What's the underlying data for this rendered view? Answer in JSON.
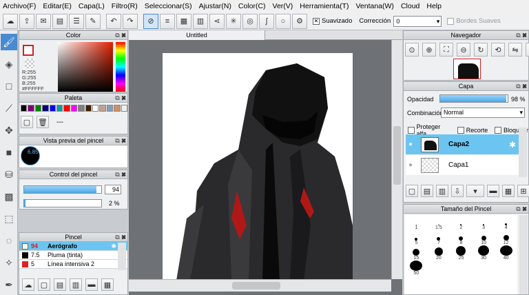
{
  "menu": [
    "Archivo(F)",
    "Editar(E)",
    "Capa(L)",
    "Filtro(R)",
    "Seleccionar(S)",
    "Ajustar(N)",
    "Color(C)",
    "Ver(V)",
    "Herramienta(T)",
    "Ventana(W)",
    "Cloud",
    "Help"
  ],
  "toolbar": {
    "smooth_label": "Suavizado",
    "correction_label": "Corrección",
    "correction_value": "0",
    "soft_edges_label": "Bordes Suaves"
  },
  "color_panel": {
    "title": "Color",
    "r": "R:255",
    "g": "G:255",
    "b": "B:255",
    "hex": "#FFFFFF"
  },
  "palette_panel": {
    "title": "Paleta",
    "dashes": "---",
    "swatches": [
      "#000000",
      "#800080",
      "#008000",
      "#000080",
      "#0000ff",
      "#00a0a0",
      "#ff0000",
      "#ff00ff",
      "#808080",
      "#402000",
      "#ffffff",
      "#c0a090",
      "#80a0c0",
      "#d09060",
      "#f0f0f0"
    ]
  },
  "brush_preview": {
    "title": "Vista previa del pincel",
    "size": "6.85"
  },
  "brush_control": {
    "title": "Control del pincel",
    "size": "94",
    "opacity": "2 %",
    "size_fill": 0.94,
    "opacity_fill": 0.02
  },
  "brush_panel": {
    "title": "Pincel",
    "items": [
      {
        "size": "94",
        "name": "Aerógrafo",
        "color": "#ffffff"
      },
      {
        "size": "7.5",
        "name": "Pluma (tinta)",
        "color": "#000000"
      },
      {
        "size": "5",
        "name": "Línea intensiva 2",
        "color": "#e02020"
      }
    ]
  },
  "document": {
    "tab": "Untitled"
  },
  "navigator": {
    "title": "Navegador"
  },
  "layer_panel": {
    "title": "Capa",
    "opacity_label": "Opacidad",
    "opacity_value": "98 %",
    "opacity_fill": 0.98,
    "blend_label": "Combinación",
    "blend_value": "Normal",
    "protect_alpha": "Proteger alfa",
    "clip": "Recorte",
    "lock": "Bloquear",
    "layers": [
      "Capa2",
      "Capa1"
    ]
  },
  "brush_size_panel": {
    "title": "Tamaño del Pincel",
    "sizes": [
      "1",
      "1.5",
      "2",
      "3",
      "4",
      "5",
      "7",
      "8",
      "10",
      "12",
      "15",
      "20",
      "25",
      "30",
      "40",
      "50"
    ]
  }
}
